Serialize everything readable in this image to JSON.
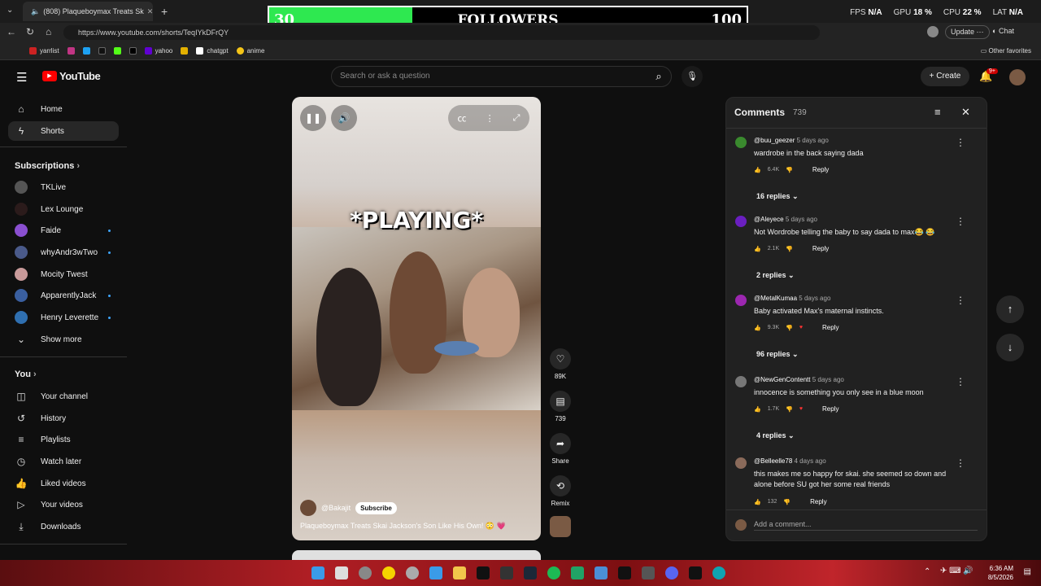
{
  "browser": {
    "tab_title": "(808) Plaqueboymax Treats Sk",
    "url": "https://www.youtube.com/shorts/TeqIYkDFrQY",
    "update_label": "Update",
    "chat_label": "Chat",
    "bookmarks": [
      "yarrlist",
      "yahoo",
      "chatgpt",
      "anime"
    ],
    "other_favorites": "Other favorites"
  },
  "overlay": {
    "followers_current": "30",
    "followers_label": "FOLLOWERS",
    "followers_goal": "100",
    "progress_fraction": 0.3,
    "fps_label": "FPS",
    "fps_value": "N/A",
    "gpu_label": "GPU",
    "gpu_value": "18 %",
    "cpu_label": "CPU",
    "cpu_value": "22 %",
    "lat_label": "LAT",
    "lat_value": "N/A"
  },
  "youtube": {
    "logo": "YouTube",
    "search_placeholder": "Search or ask a question",
    "create_label": "Create",
    "notif_badge": "9+"
  },
  "sidebar": {
    "home": "Home",
    "shorts": "Shorts",
    "subscriptions": "Subscriptions",
    "subs": [
      "TKLive",
      "Lex Lounge",
      "Faide",
      "whyAndr3wTwo",
      "Mocity Twest",
      "ApparentlyJack",
      "Henry Leverette"
    ],
    "show_more": "Show more",
    "you": "You",
    "you_items": [
      "Your channel",
      "History",
      "Playlists",
      "Watch later",
      "Liked videos",
      "Your videos",
      "Downloads"
    ]
  },
  "video": {
    "overlay_text": "*PLAYING*",
    "channel": "@Bakajit",
    "subscribe": "Subscribe",
    "title": "Plaqueboymax Treats Skai Jackson's Son Like His Own! 😳 💗",
    "likes": "89K",
    "comments": "739",
    "share": "Share",
    "remix": "Remix"
  },
  "comments": {
    "title": "Comments",
    "count": "739",
    "add_placeholder": "Add a comment...",
    "reply_label": "Reply",
    "items": [
      {
        "user": "@buu_geezer",
        "ago": "5 days ago",
        "text": "wardrobe in the back saying dada",
        "likes": "6.4K",
        "replies": "16 replies"
      },
      {
        "user": "@Aleyece",
        "ago": "5 days ago",
        "text": "Not Wordrobe telling the baby to say dada to max😂 😂",
        "likes": "2.1K",
        "replies": "2 replies"
      },
      {
        "user": "@MetalKumaa",
        "ago": "5 days ago",
        "text": "Baby activated Max's maternal instincts.",
        "likes": "9.3K",
        "replies": "96 replies"
      },
      {
        "user": "@NewGenContentt",
        "ago": "5 days ago",
        "text": "innocence is something you only see in a blue moon",
        "likes": "1.7K",
        "replies": "4 replies"
      },
      {
        "user": "@Belleelle78",
        "ago": "4 days ago",
        "text": "this makes me so happy for skai. she seemed so down and alone before SU got her some real friends",
        "likes": "132",
        "replies": ""
      }
    ]
  },
  "taskbar": {
    "time": "6:36 AM",
    "date": "8/5/2026"
  }
}
